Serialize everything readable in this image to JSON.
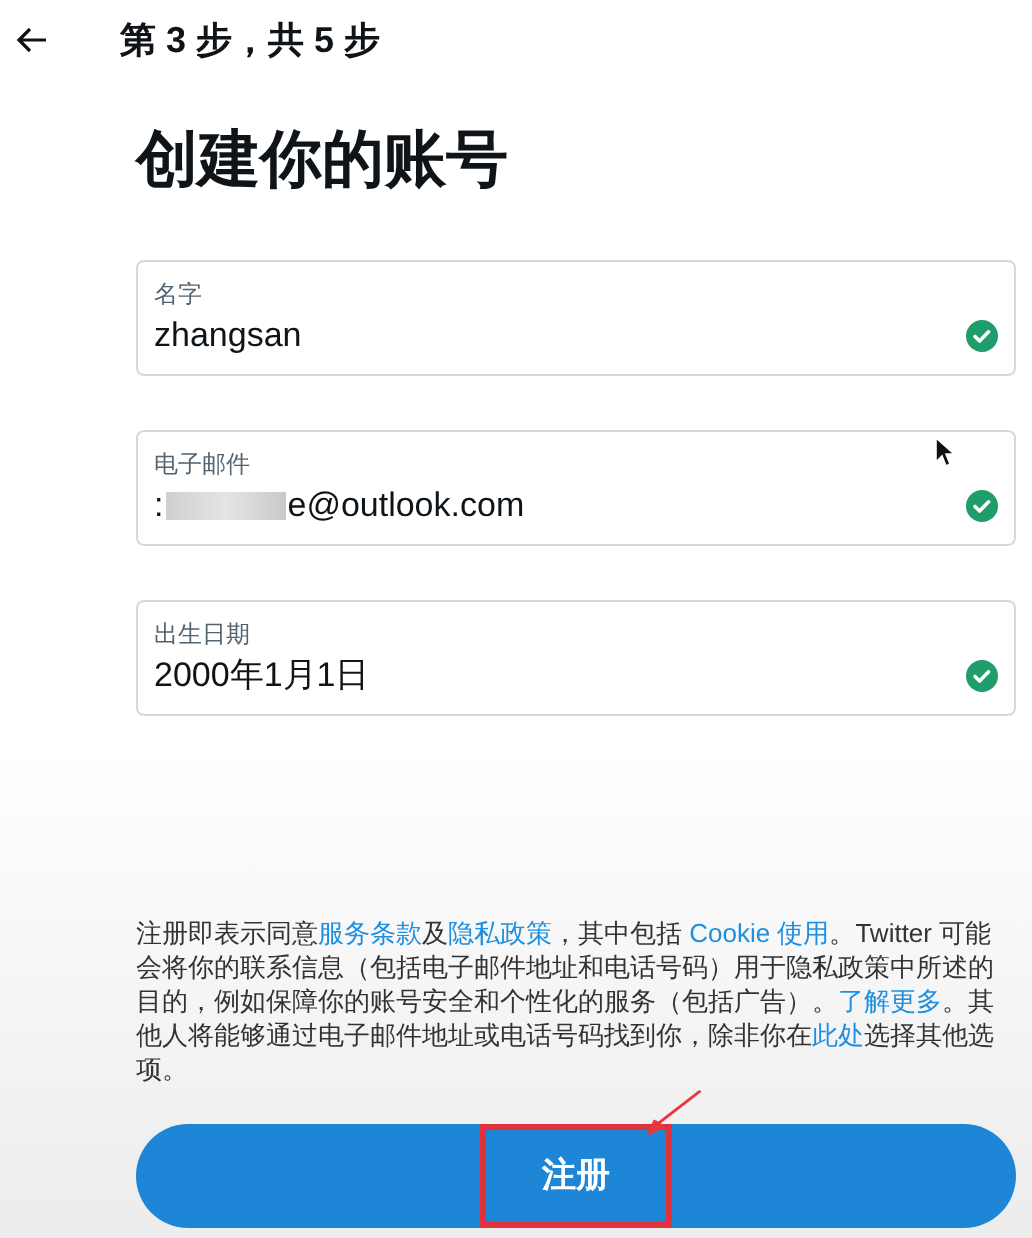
{
  "header": {
    "step": "第 3 步，共 5 步"
  },
  "title": "创建你的账号",
  "fields": [
    {
      "label": "名字",
      "value": "zhangsan",
      "valid": true
    },
    {
      "label": "电子邮件",
      "value": ":",
      "redacted": true,
      "value_end": "e@outlook.com",
      "valid": true
    },
    {
      "label": "出生日期",
      "value": "2000年1月1日",
      "valid": true
    }
  ],
  "terms": [
    {
      "text": "注册即表示同意",
      "link": false
    },
    {
      "text": "服务条款",
      "link": true
    },
    {
      "text": "及",
      "link": false
    },
    {
      "text": "隐私政策",
      "link": true
    },
    {
      "text": "，其中包括 ",
      "link": false
    },
    {
      "text": "Cookie 使用",
      "link": true
    },
    {
      "text": "。Twitter 可能会将你的联系信息（包括电子邮件地址和电话号码）用于隐私政策中所述的目的，例如保障你的账号安全和个性化的服务（包括广告）。",
      "link": false
    },
    {
      "text": "了解更多",
      "link": true
    },
    {
      "text": "。其他人将能够通过电子邮件地址或电话号码找到你，除非你在",
      "link": false
    },
    {
      "text": "此处",
      "link": true
    },
    {
      "text": "选择其他选项。",
      "link": false
    }
  ],
  "submit": {
    "label": "注册",
    "highlighted": true
  }
}
